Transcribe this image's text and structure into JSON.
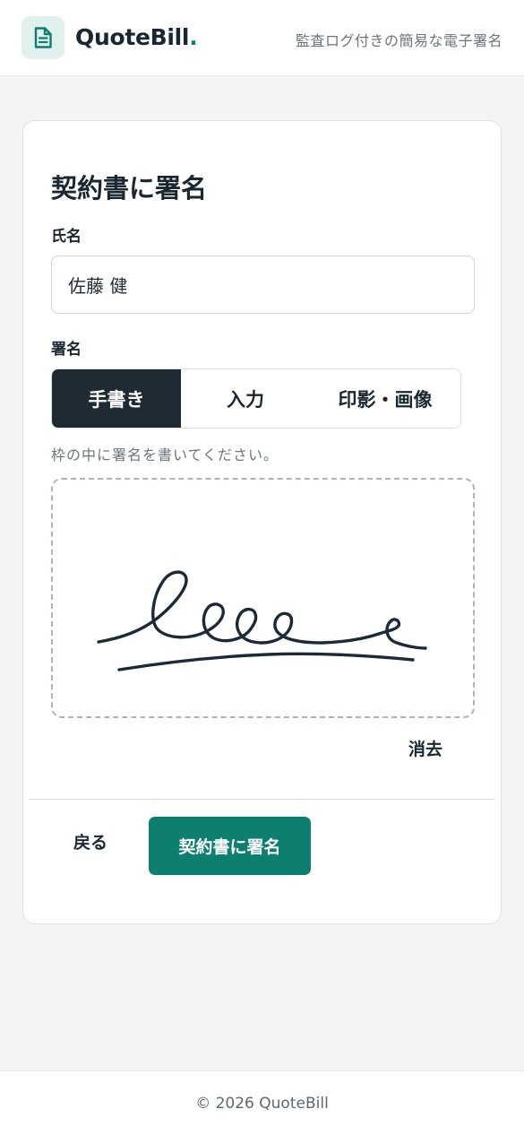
{
  "header": {
    "brand_name": "QuoteBill",
    "brand_dot": ".",
    "tagline": "監査ログ付きの簡易な電子署名",
    "logo_icon": "document-icon",
    "accent_color": "#0d7f6e"
  },
  "form": {
    "title": "契約書に署名",
    "name_label": "氏名",
    "name_value": "佐藤 健",
    "signature_label": "署名",
    "tabs": [
      {
        "label": "手書き",
        "active": true
      },
      {
        "label": "入力",
        "active": false
      },
      {
        "label": "印影・画像",
        "active": false
      }
    ],
    "hint": "枠の中に署名を書いてください。",
    "clear_label": "消去",
    "back_label": "戻る",
    "submit_label": "契約書に署名"
  },
  "footer": {
    "copyright": "© 2026 QuoteBill"
  }
}
